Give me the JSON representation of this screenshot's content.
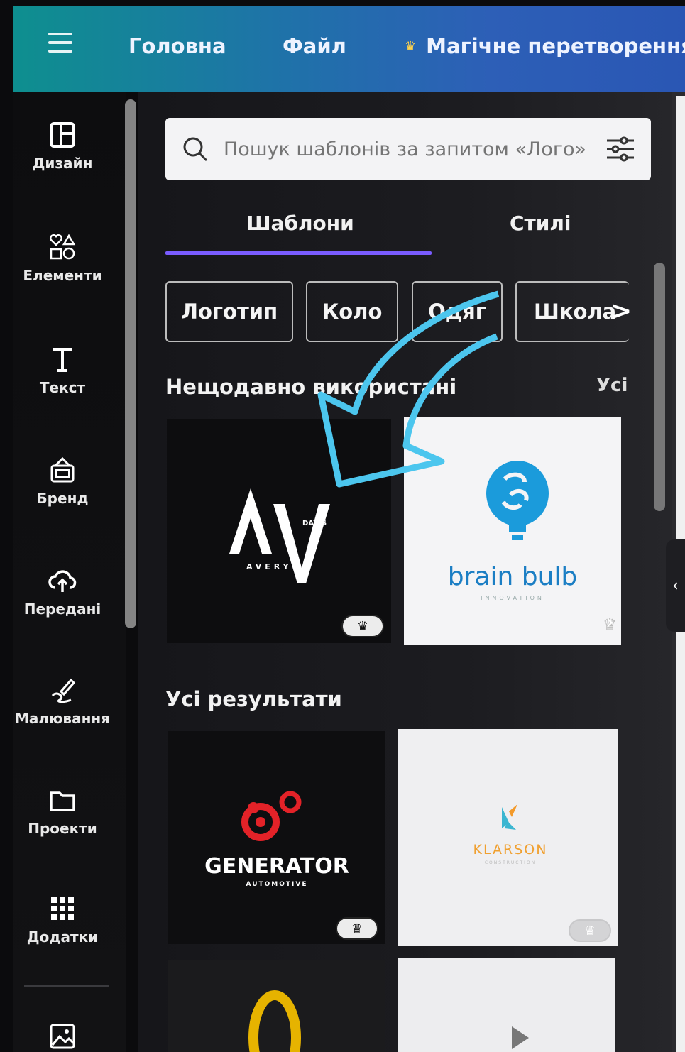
{
  "topbar": {
    "home": "Головна",
    "file": "Файл",
    "magic": "Магічне перетворення"
  },
  "rail": {
    "items": [
      {
        "label": "Дизайн",
        "icon": "layout-icon"
      },
      {
        "label": "Елементи",
        "icon": "shapes-icon"
      },
      {
        "label": "Текст",
        "icon": "text-icon"
      },
      {
        "label": "Бренд",
        "icon": "brand-icon"
      },
      {
        "label": "Передані",
        "icon": "cloud-upload-icon"
      },
      {
        "label": "Малювання",
        "icon": "draw-icon"
      },
      {
        "label": "Проекти",
        "icon": "folder-icon"
      },
      {
        "label": "Додатки",
        "icon": "apps-icon"
      }
    ]
  },
  "search": {
    "placeholder": "Пошук шаблонів за запитом «Лого»"
  },
  "tabs": {
    "templates": "Шаблони",
    "styles": "Стилі"
  },
  "chips": [
    "Логотип",
    "Коло",
    "Одяг",
    "Школа"
  ],
  "sections": {
    "recent": "Нещодавно використані",
    "see_all": "Усі",
    "all_results": "Усі результати"
  },
  "cards": {
    "avery": {
      "name": "AVERY",
      "sub": "DAVIS"
    },
    "brain": {
      "name": "brain bulb",
      "sub": "INNOVATION"
    },
    "generator": {
      "name": "GENERATOR",
      "sub": "AUTOMOTIVE"
    },
    "klarson": {
      "name": "KLARSON",
      "sub": "CONSTRUCTION"
    }
  },
  "colors": {
    "accent": "#7a5cff",
    "topbar_start": "#0e8f8f",
    "topbar_end": "#2a56b4",
    "arrow": "#4cc6ee"
  }
}
